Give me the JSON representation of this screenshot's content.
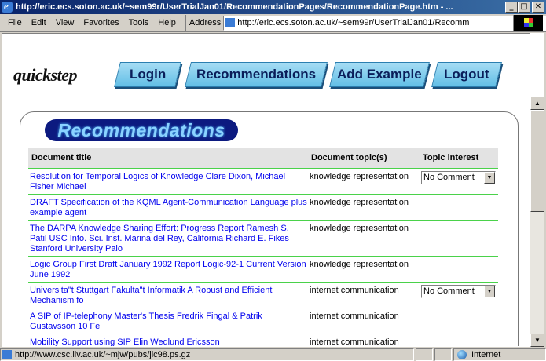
{
  "window": {
    "title": "http://eric.ecs.soton.ac.uk/~sem99r/UserTrialJan01/RecommendationPages/RecommendationPage.htm - ...",
    "min": "_",
    "max": "□",
    "close": "✕"
  },
  "menu": {
    "items": [
      "File",
      "Edit",
      "View",
      "Favorites",
      "Tools",
      "Help"
    ],
    "address_label": "Address",
    "address_value": "http://eric.ecs.soton.ac.uk/~sem99r/UserTrialJan01/Recomm"
  },
  "page": {
    "logo": "quickstep",
    "nav": {
      "login": "Login",
      "recommendations": "Recommendations",
      "add_example": "Add Example",
      "logout": "Logout"
    },
    "heading": "Recommendations",
    "table": {
      "headers": [
        "Document title",
        "Document topic(s)",
        "Topic interest"
      ],
      "rows": [
        {
          "title": "Resolution for Temporal Logics of Knowledge  Clare Dixon, Michael Fisher Michael",
          "topic": "knowledge representation",
          "interest": "No Comment"
        },
        {
          "title": "DRAFT Specification of the KQML Agent-Communication Language  plus example agent",
          "topic": "knowledge representation",
          "interest": ""
        },
        {
          "title": "The DARPA Knowledge Sharing Effort: Progress Report  Ramesh S. Patil USC Info. Sci. Inst. Marina del Rey, California  Richard E. Fikes Stanford University Palo",
          "topic": "knowledge representation",
          "interest": ""
        },
        {
          "title": "Logic Group First Draft January 1992 Report Logic-92-1 Current Version June 1992",
          "topic": "knowledge representation",
          "interest": ""
        },
        {
          "title": "Universita\"t Stuttgart Fakulta\"t Informatik  A Robust and Efficient Mechanism fo",
          "topic": "internet communication",
          "interest": "No Comment"
        },
        {
          "title": "A SIP of IP-telephony  Master's Thesis Fredrik Fingal & Patrik Gustavsson  10 Fe",
          "topic": "internet communication",
          "interest": ""
        },
        {
          "title": "Mobility Support using SIP Elin Wedlund Ericsson",
          "topic": "internet communication",
          "interest": ""
        }
      ]
    }
  },
  "status": {
    "url": "http://www.csc.liv.ac.uk/~mjw/pubs/jlc98.ps.gz",
    "zone": "Internet"
  }
}
